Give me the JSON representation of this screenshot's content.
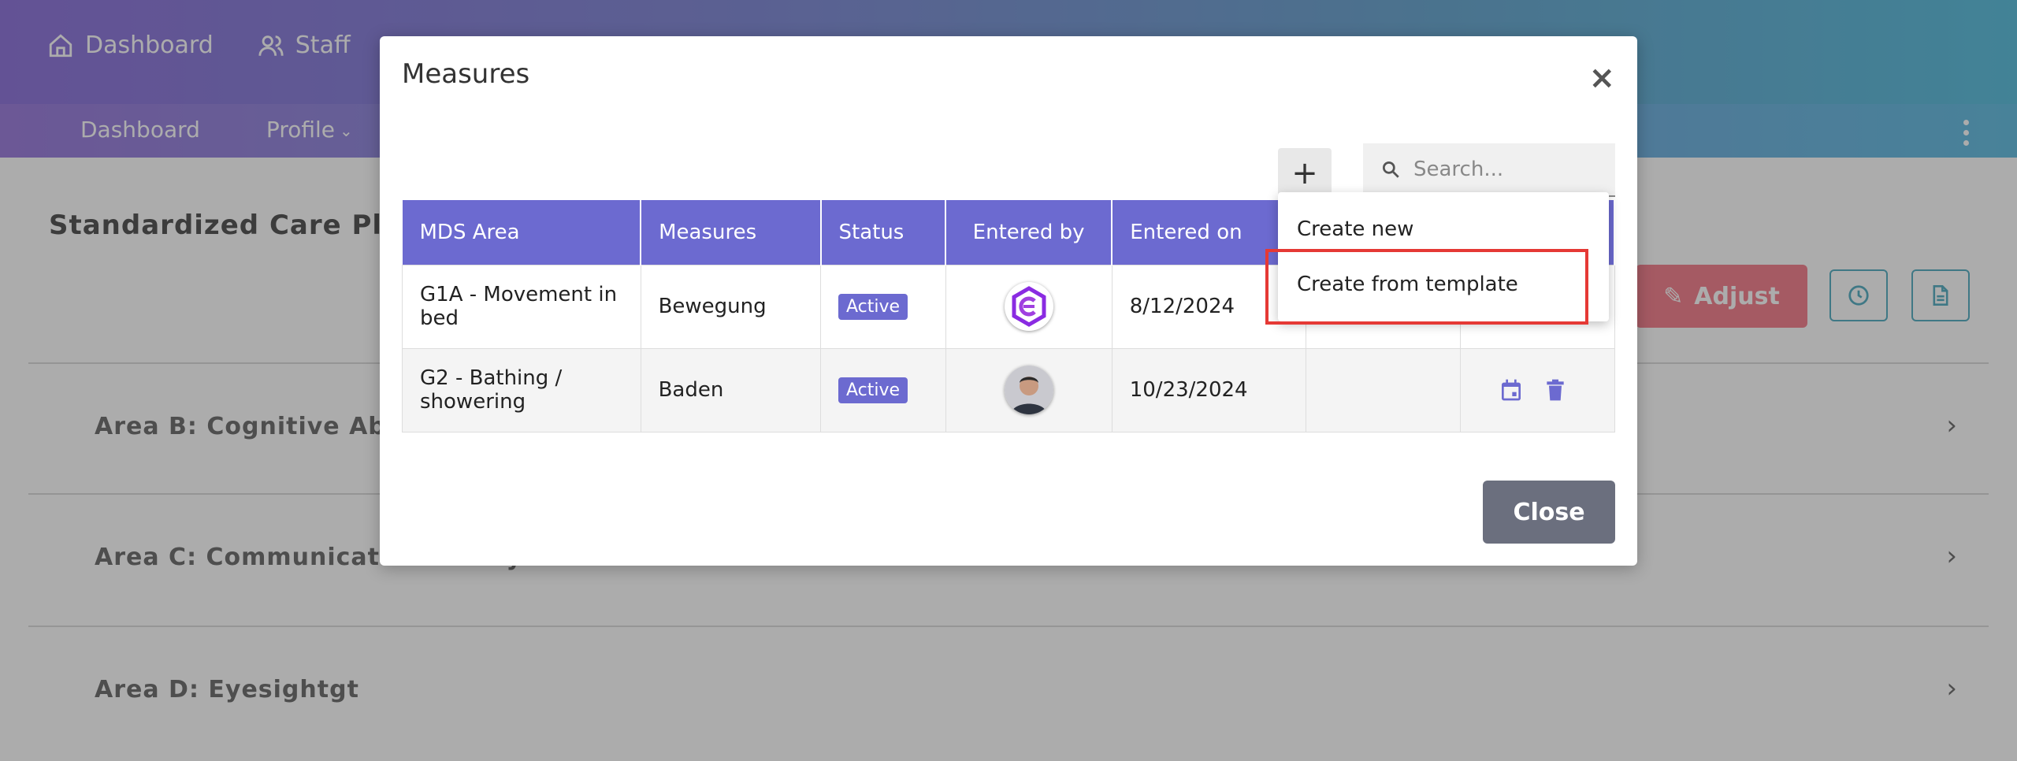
{
  "nav": {
    "top_items": [
      {
        "label": "Dashboard",
        "icon": "home-icon"
      },
      {
        "label": "Staff",
        "icon": "users-icon"
      }
    ],
    "sub_items": [
      {
        "label": "Dashboard"
      },
      {
        "label": "Profile"
      }
    ]
  },
  "page": {
    "title": "Standardized Care Plan",
    "adjust_label": "Adjust",
    "areas": [
      {
        "label": "Area B: Cognitive Ability"
      },
      {
        "label": "Area C: Communicative Ability"
      },
      {
        "label": "Area D: Eyesightgt"
      }
    ]
  },
  "modal": {
    "title": "Measures",
    "close_x": "×",
    "add_label": "+",
    "search_placeholder": "Search...",
    "columns": [
      "MDS Area",
      "Measures",
      "Status",
      "Entered by",
      "Entered on"
    ],
    "rows": [
      {
        "area": "G1A - Movement in bed",
        "measure": "Bewegung",
        "status": "Active",
        "entered_by": "logo-avatar",
        "entered_on": "8/12/2024"
      },
      {
        "area": "G2 - Bathing / showering",
        "measure": "Baden",
        "status": "Active",
        "entered_by": "person-avatar",
        "entered_on": "10/23/2024"
      }
    ],
    "close_label": "Close",
    "dropdown": {
      "items": [
        {
          "label": "Create new"
        },
        {
          "label": "Create from template"
        }
      ]
    }
  },
  "colors": {
    "accent": "#6c6ad0",
    "adjust": "#f26a7a",
    "highlight": "#e53935",
    "close_button": "#6b6f7e"
  }
}
